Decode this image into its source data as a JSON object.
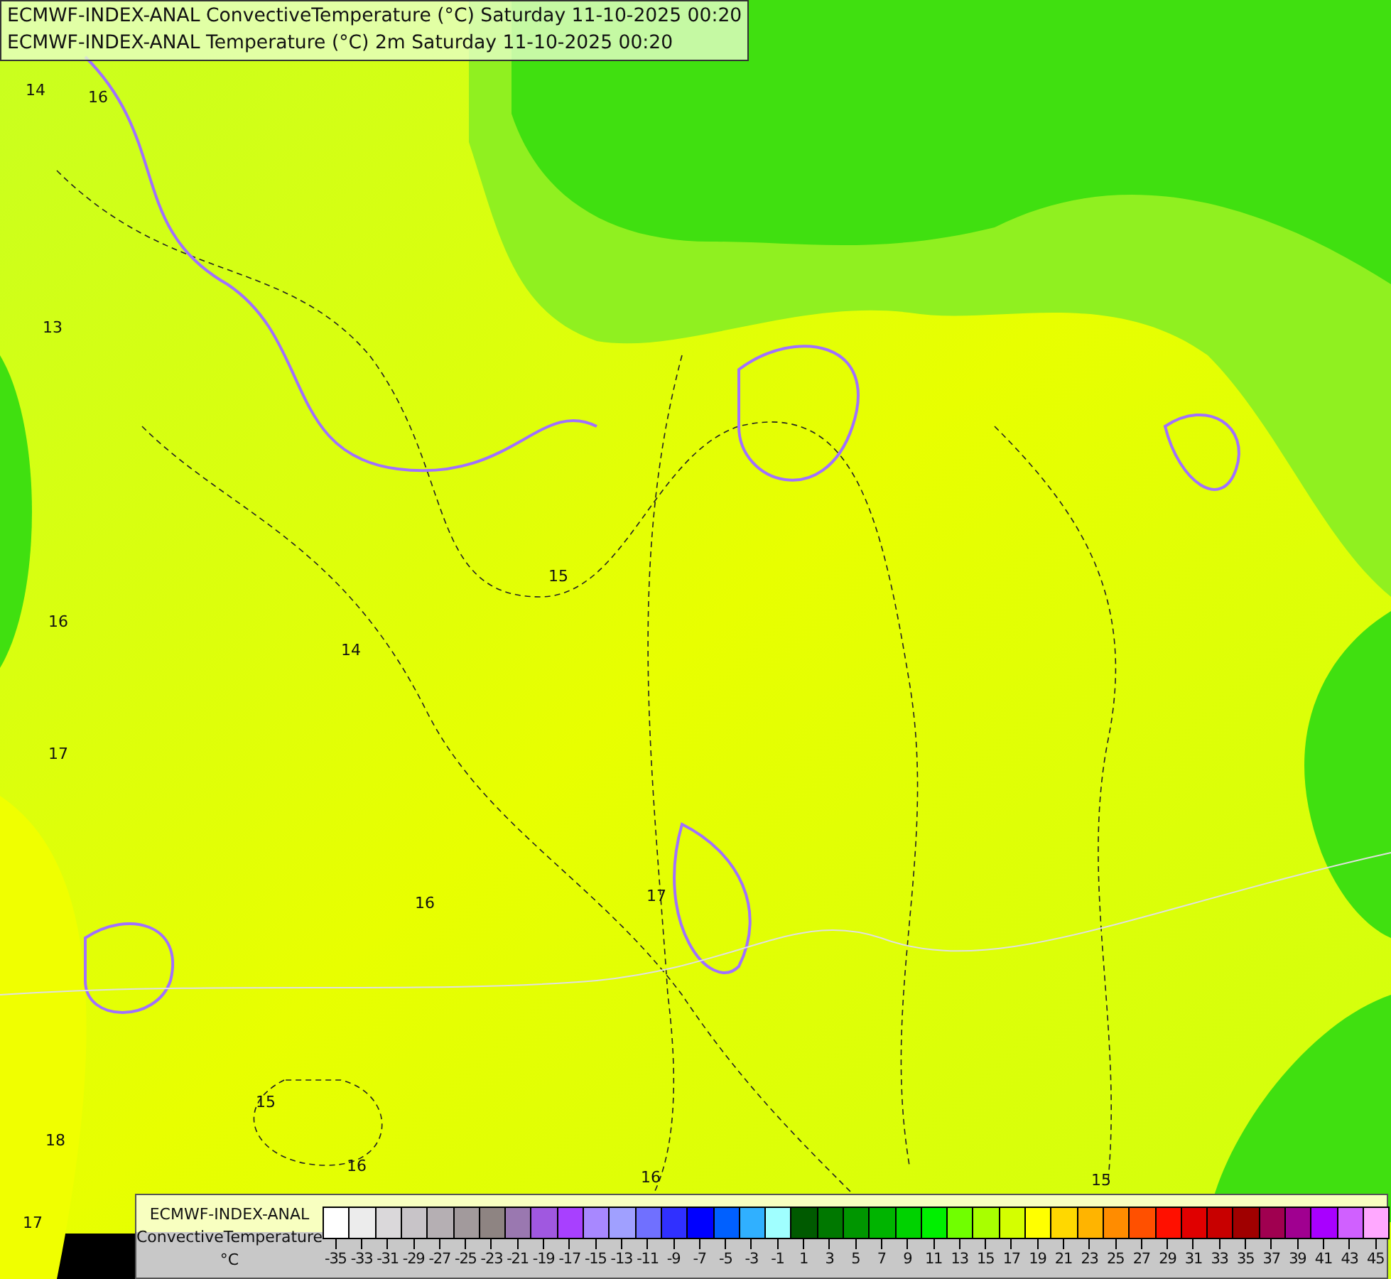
{
  "titles": [
    "ECMWF-INDEX-ANAL ConvectiveTemperature (°C) Saturday 11-10-2025 00:20",
    "ECMWF-INDEX-ANAL Temperature (°C) 2m Saturday 11-10-2025 00:20"
  ],
  "contour_labels": [
    "14",
    "16",
    "13",
    "16",
    "17",
    "15",
    "14",
    "16",
    "17",
    "15",
    "18",
    "16",
    "17",
    "16",
    "15"
  ],
  "legend": {
    "model": "ECMWF-INDEX-ANAL",
    "parameter": "ConvectiveTemperature",
    "unit": "°C",
    "swatches": [
      {
        "label": "-35",
        "color": "#ffffff"
      },
      {
        "label": "-33",
        "color": "#ececec"
      },
      {
        "label": "-31",
        "color": "#dad8da"
      },
      {
        "label": "-29",
        "color": "#c8c4c8"
      },
      {
        "label": "-27",
        "color": "#b5afb3"
      },
      {
        "label": "-25",
        "color": "#a29a9c"
      },
      {
        "label": "-23",
        "color": "#8e8482"
      },
      {
        "label": "-21",
        "color": "#9a78b0"
      },
      {
        "label": "-19",
        "color": "#a058e0"
      },
      {
        "label": "-17",
        "color": "#a840ff"
      },
      {
        "label": "-15",
        "color": "#a888ff"
      },
      {
        "label": "-13",
        "color": "#a0a0ff"
      },
      {
        "label": "-11",
        "color": "#7070ff"
      },
      {
        "label": "-9",
        "color": "#3030ff"
      },
      {
        "label": "-7",
        "color": "#0000ff"
      },
      {
        "label": "-5",
        "color": "#0060ff"
      },
      {
        "label": "-3",
        "color": "#30b0ff"
      },
      {
        "label": "-1",
        "color": "#a0ffff"
      },
      {
        "label": "1",
        "color": "#005a00"
      },
      {
        "label": "3",
        "color": "#007800"
      },
      {
        "label": "5",
        "color": "#009600"
      },
      {
        "label": "7",
        "color": "#00b400"
      },
      {
        "label": "9",
        "color": "#00d200"
      },
      {
        "label": "11",
        "color": "#00f000"
      },
      {
        "label": "13",
        "color": "#70ff00"
      },
      {
        "label": "15",
        "color": "#a8ff00"
      },
      {
        "label": "17",
        "color": "#d4ff00"
      },
      {
        "label": "19",
        "color": "#ffff00"
      },
      {
        "label": "21",
        "color": "#ffd800"
      },
      {
        "label": "23",
        "color": "#ffb400"
      },
      {
        "label": "25",
        "color": "#ff8c00"
      },
      {
        "label": "27",
        "color": "#ff5000"
      },
      {
        "label": "29",
        "color": "#ff1000"
      },
      {
        "label": "31",
        "color": "#e00000"
      },
      {
        "label": "33",
        "color": "#c80000"
      },
      {
        "label": "35",
        "color": "#a00000"
      },
      {
        "label": "37",
        "color": "#a00050"
      },
      {
        "label": "39",
        "color": "#a00090"
      },
      {
        "label": "41",
        "color": "#a800ff"
      },
      {
        "label": "43",
        "color": "#d060ff"
      },
      {
        "label": "45",
        "color": "#ffa8ff"
      }
    ]
  }
}
